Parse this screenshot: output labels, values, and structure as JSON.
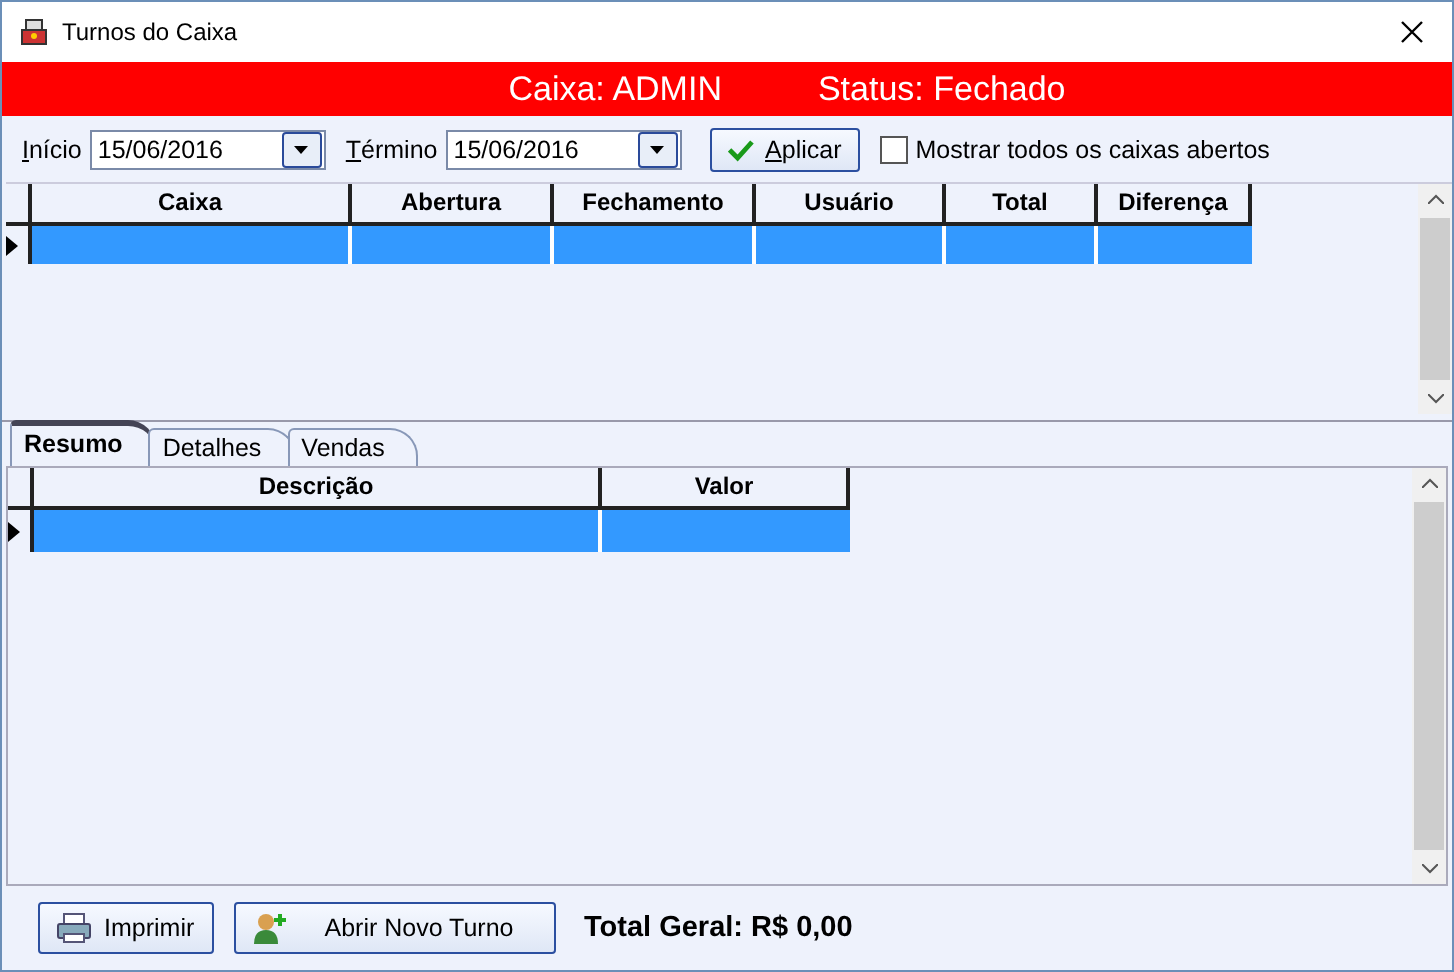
{
  "window": {
    "title": "Turnos do Caixa"
  },
  "header": {
    "caixa": "Caixa: ADMIN",
    "status": "Status: Fechado"
  },
  "filters": {
    "start_label": "Início",
    "start_value": "15/06/2016",
    "end_label": "Término",
    "end_value": "15/06/2016",
    "apply_button": "Aplicar",
    "show_all": {
      "label": "Mostrar todos os caixas abertos",
      "checked": false
    }
  },
  "shifts_table": {
    "columns": [
      "Caixa",
      "Abertura",
      "Fechamento",
      "Usuário",
      "Total",
      "Diferença"
    ],
    "rows": [
      {
        "selected": true
      }
    ]
  },
  "tabs": [
    {
      "label": "Resumo",
      "selected": true
    },
    {
      "label": "Detalhes",
      "selected": false
    },
    {
      "label": "Vendas",
      "selected": false
    }
  ],
  "summary_table": {
    "columns": [
      "Descrição",
      "Valor"
    ],
    "rows": [
      {
        "selected": true
      }
    ]
  },
  "buttons": [
    "Imprimir",
    "Abrir Novo Turno"
  ],
  "total": "Total Geral: R$ 0,00"
}
